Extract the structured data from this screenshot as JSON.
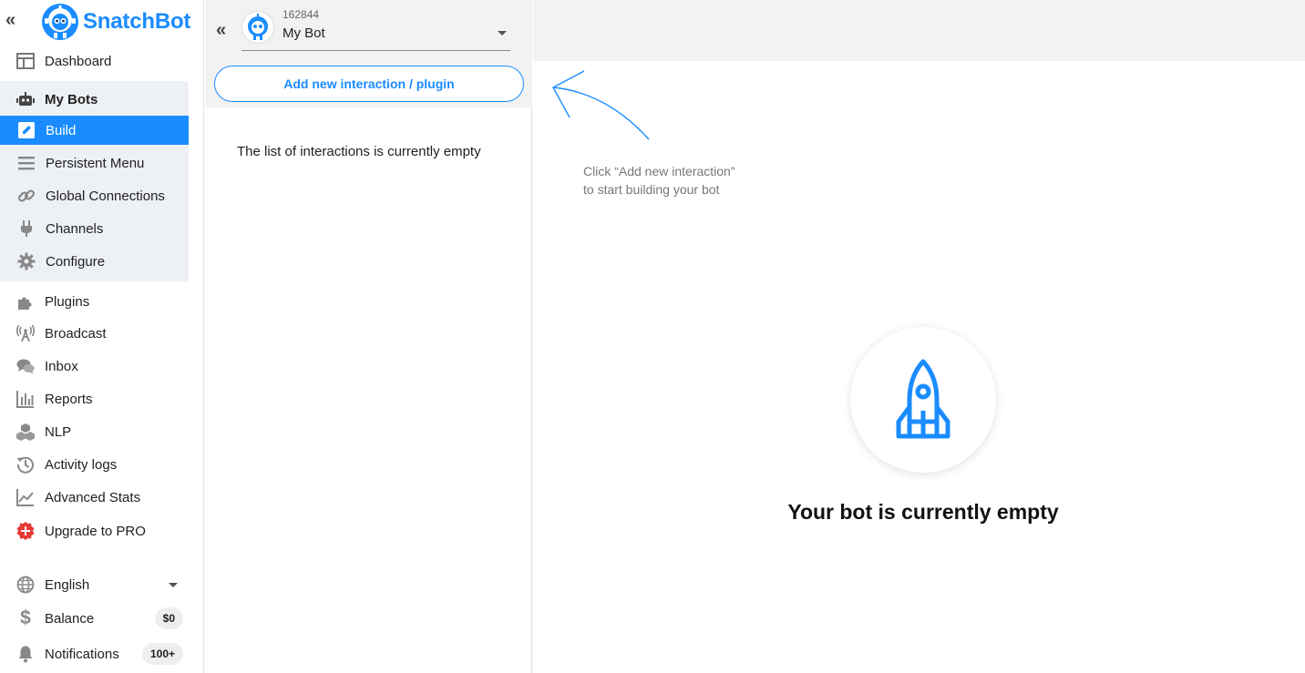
{
  "brand": {
    "name": "SnatchBot",
    "accent": "#1a8cff"
  },
  "sidebar": {
    "collapse_glyph": "«",
    "dashboard": "Dashboard",
    "my_bots": "My Bots",
    "sub_items": [
      {
        "label": "Build",
        "icon": "pencil-icon",
        "active": true
      },
      {
        "label": "Persistent Menu",
        "icon": "menu-icon"
      },
      {
        "label": "Global Connections",
        "icon": "link-icon"
      },
      {
        "label": "Channels",
        "icon": "plug-icon"
      },
      {
        "label": "Configure",
        "icon": "gear-icon"
      }
    ],
    "items": [
      {
        "label": "Plugins",
        "icon": "puzzle-icon"
      },
      {
        "label": "Broadcast",
        "icon": "broadcast-icon"
      },
      {
        "label": "Inbox",
        "icon": "chat-icon"
      },
      {
        "label": "Reports",
        "icon": "bar-chart-icon"
      },
      {
        "label": "NLP",
        "icon": "cubes-icon"
      },
      {
        "label": "Activity logs",
        "icon": "history-icon"
      },
      {
        "label": "Advanced Stats",
        "icon": "line-chart-icon"
      },
      {
        "label": "Upgrade to PRO",
        "icon": "upgrade-icon"
      }
    ],
    "language": "English",
    "balance_label": "Balance",
    "balance_value": "$0",
    "notifications_label": "Notifications",
    "notifications_count": "100+"
  },
  "middle": {
    "collapse_glyph": "«",
    "bot_id": "162844",
    "bot_name": "My Bot",
    "add_button": "Add new interaction / plugin",
    "empty_text": "The list of interactions is currently empty"
  },
  "right": {
    "hint_line1": "Click “Add new interaction”",
    "hint_line2": "to start building your bot",
    "empty_title": "Your bot is currently empty"
  }
}
